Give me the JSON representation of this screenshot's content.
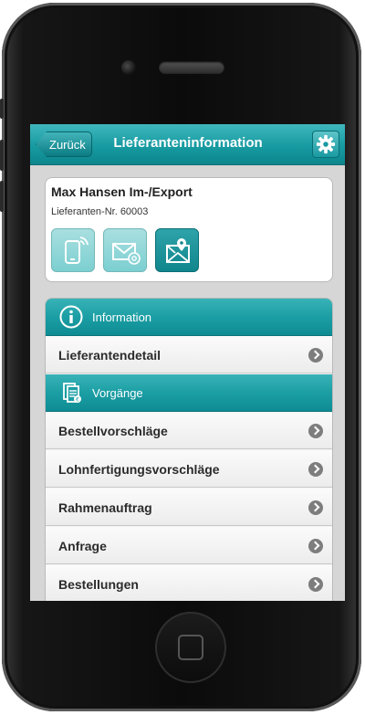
{
  "header": {
    "back_label": "Zurück",
    "title": "Lieferanteninformation",
    "settings_icon": "gear-icon"
  },
  "supplier": {
    "name": "Max Hansen Im-/Export",
    "number": "Lieferanten-Nr. 60003",
    "actions": [
      {
        "icon": "phone-icon"
      },
      {
        "icon": "email-icon"
      },
      {
        "icon": "map-letter-icon"
      }
    ]
  },
  "sections": [
    {
      "title": "Information",
      "icon": "info-icon",
      "items": [
        "Lieferantendetail"
      ]
    },
    {
      "title": "Vorgänge",
      "icon": "documents-icon",
      "items": [
        "Bestellvorschläge",
        "Lohnfertigungsvorschläge",
        "Rahmenauftrag",
        "Anfrage",
        "Bestellungen"
      ]
    }
  ],
  "colors": {
    "accent": "#179aa1",
    "accent_dark": "#0d868d",
    "accent_light": "#a9dfe0"
  }
}
